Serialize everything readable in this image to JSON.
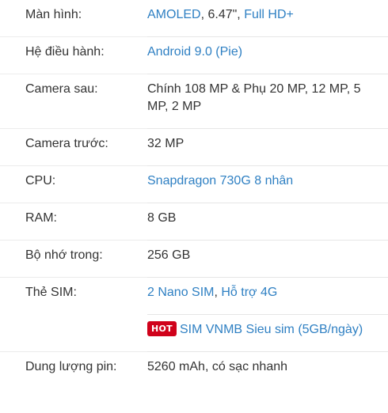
{
  "specs": {
    "screen": {
      "label": "Màn hình:",
      "part1": "AMOLED",
      "sep": ", 6.47\", ",
      "part2": "Full HD+"
    },
    "os": {
      "label": "Hệ điều hành:",
      "value": "Android 9.0 (Pie)"
    },
    "rear_camera": {
      "label": "Camera sau:",
      "value": "Chính 108 MP & Phụ 20 MP, 12 MP, 5 MP, 2 MP"
    },
    "front_camera": {
      "label": "Camera trước:",
      "value": "32 MP"
    },
    "cpu": {
      "label": "CPU:",
      "value": "Snapdragon 730G 8 nhân"
    },
    "ram": {
      "label": "RAM:",
      "value": "8 GB"
    },
    "storage": {
      "label": "Bộ nhớ trong:",
      "value": "256 GB"
    },
    "sim": {
      "label": "Thẻ SIM:",
      "part1": "2 Nano SIM",
      "sep": ", ",
      "part2": "Hỗ trợ 4G",
      "badge": "HOT",
      "promo": "SIM VNMB Sieu sim (5GB/ngày)"
    },
    "battery": {
      "label": "Dung lượng pin:",
      "value": "5260 mAh, có sạc nhanh"
    }
  },
  "colors": {
    "link": "#2f80c3",
    "text": "#333333",
    "hot_badge": "#d0021b",
    "divider": "#e6e6e6"
  }
}
